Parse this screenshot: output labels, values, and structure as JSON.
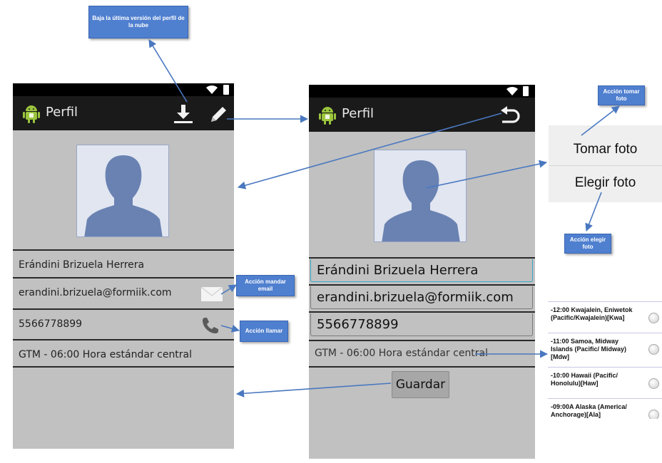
{
  "phone_view": {
    "title": "Perfil",
    "name": "Erándini Brizuela Herrera",
    "email": "erandini.brizuela@formiik.com",
    "phone": "5566778899",
    "timezone": "GTM - 06:00 Hora estándar central",
    "icons": {
      "download": "download-icon",
      "edit": "pencil-icon",
      "mail": "mail-icon",
      "call": "phone-icon"
    }
  },
  "phone_edit": {
    "title": "Perfil",
    "name_value": "Erándini Brizuela Herrera",
    "email_value": "erandini.brizuela@formiik.com",
    "phone_value": "5566778899",
    "timezone": "GTM - 06:00 Hora estándar central",
    "save_label": "Guardar",
    "icons": {
      "back": "undo-icon"
    }
  },
  "photo_menu": {
    "items": [
      "Tomar foto",
      "Elegir foto"
    ]
  },
  "tz_list": {
    "items": [
      "-12:00  Kwajalein, Eniwetok (Pacific/Kwajalein)[Kwa]",
      "-11:00  Samoa, Midway Islands (Pacific/ Midway)[Mdw]",
      "-10:00  Hawaii (Pacific/ Honolulu)[Haw]",
      "-09:00A Alaska (America/ Anchorage)[Ala]"
    ]
  },
  "callouts": {
    "download": "Baja la última versión del perfil de la nube",
    "take_photo": "Acción tomar foto",
    "choose_photo": "Acción elegir foto",
    "send_email": "Acción mandar email",
    "call": "Acción llamar"
  },
  "colors": {
    "callout": "#4f7fcf",
    "arrow": "#4a78c0",
    "phone_bg": "#c1c1c1",
    "action_bar": "#1a1a1a",
    "focus": "#39a5c6"
  }
}
